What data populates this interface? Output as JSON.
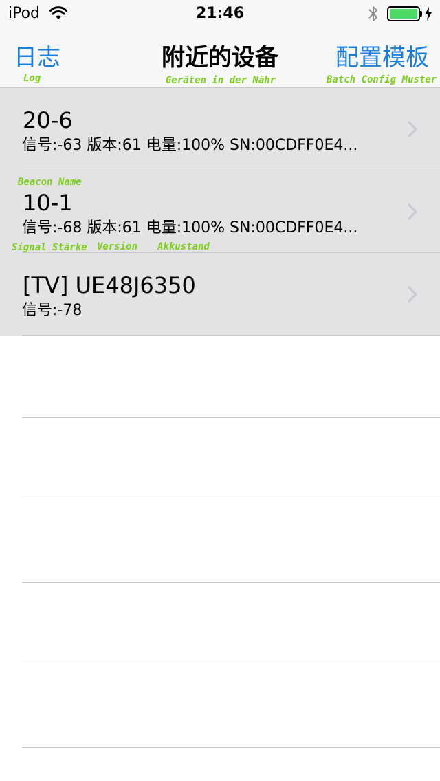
{
  "status_bar": {
    "carrier": "iPod",
    "time": "21:46",
    "battery_level": 1.0,
    "icons": [
      "wifi-icon",
      "bluetooth-icon",
      "battery-icon",
      "charging-bolt-icon"
    ]
  },
  "nav": {
    "left_label": "日志",
    "title": "附近的设备",
    "right_label": "配置模板"
  },
  "annotations": {
    "log": "Log",
    "title": "Geräten in der Nähr",
    "config": "Batch Config Muster",
    "beacon_name": "Beacon Name",
    "signal": "Signal Stärke",
    "version": "Version",
    "battery": "Akkustand"
  },
  "devices": [
    {
      "name": "20-6",
      "detail": "信号:-63 版本:61 电量:100% SN:00CDFF0E4..."
    },
    {
      "name": "10-1",
      "detail": "信号:-68 版本:61 电量:100% SN:00CDFF0E4..."
    },
    {
      "name": "[TV] UE48J6350",
      "detail": "信号:-78"
    }
  ],
  "colors": {
    "accent": "#1a7fe0",
    "annotation": "#7ccf1f",
    "battery_fill": "#4cd964",
    "row_background": "#e3e3e3",
    "separator": "#c8c7cc"
  }
}
